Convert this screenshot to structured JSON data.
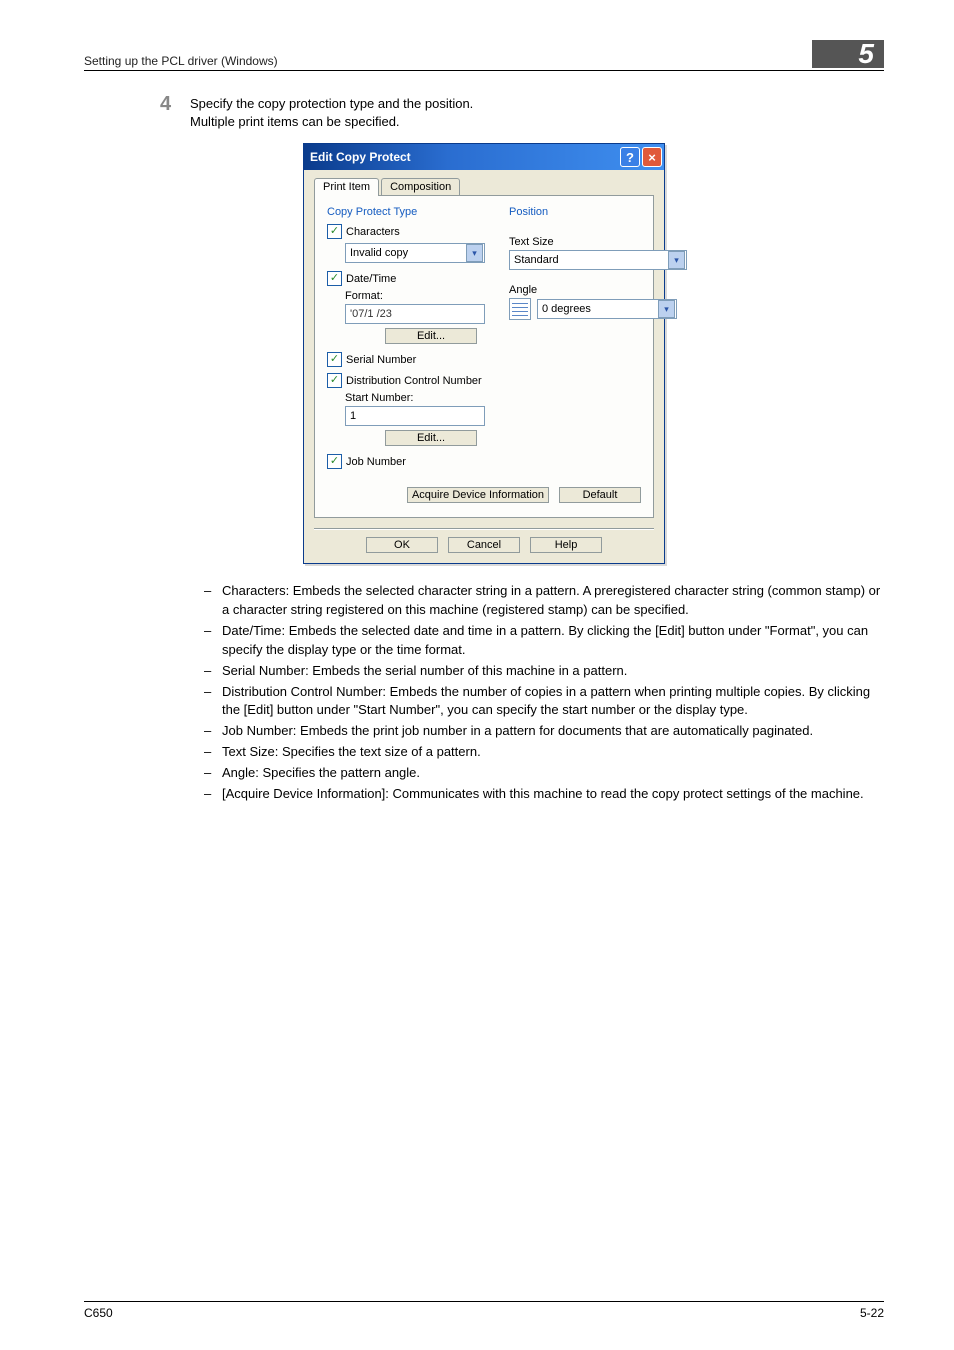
{
  "header": {
    "left": "Setting up the PCL driver (Windows)",
    "right": "5"
  },
  "step": {
    "number": "4",
    "line1": "Specify the copy protection type and the position.",
    "line2": "Multiple print items can be specified."
  },
  "dialog": {
    "title": "Edit Copy Protect",
    "tabs": {
      "print_item": "Print Item",
      "composition": "Composition"
    },
    "left_group_title": "Copy Protect Type",
    "characters_label": "Characters",
    "characters_value": "Invalid copy",
    "date_label": "Date/Time",
    "format_label": "Format:",
    "format_value": "'07/1 /23",
    "edit_label": "Edit...",
    "serial_label": "Serial Number",
    "dist_label": "Distribution Control Number",
    "start_label": "Start Number:",
    "start_value": "1",
    "job_label": "Job Number",
    "right_group_title": "Position",
    "text_size_label": "Text Size",
    "text_size_value": "Standard",
    "angle_label": "Angle",
    "angle_value": "0 degrees",
    "acquire_label": "Acquire Device Information",
    "default_label": "Default",
    "ok_label": "OK",
    "cancel_label": "Cancel",
    "help_label": "Help"
  },
  "notes": {
    "i1": "Characters: Embeds the selected character string in a pattern. A preregistered character string (common stamp) or a character string registered on this machine (registered stamp) can be specified.",
    "i2": "Date/Time: Embeds the selected date and time in a pattern. By clicking the [Edit] button under \"Format\", you can specify the display type or the time format.",
    "i3": "Serial Number: Embeds the serial number of this machine in a pattern.",
    "i4": "Distribution Control Number: Embeds the number of copies in a pattern when printing multiple copies. By clicking the [Edit] button under \"Start Number\", you can specify the start number or the display type.",
    "i5": "Job Number: Embeds the print job number in a pattern for documents that are automatically paginated.",
    "i6": "Text Size: Specifies the text size of a pattern.",
    "i7": "Angle: Specifies the pattern angle.",
    "i8": "[Acquire Device Information]: Communicates with this machine to read the copy protect settings of the machine."
  },
  "footer": {
    "left": "C650",
    "right": "5-22"
  }
}
